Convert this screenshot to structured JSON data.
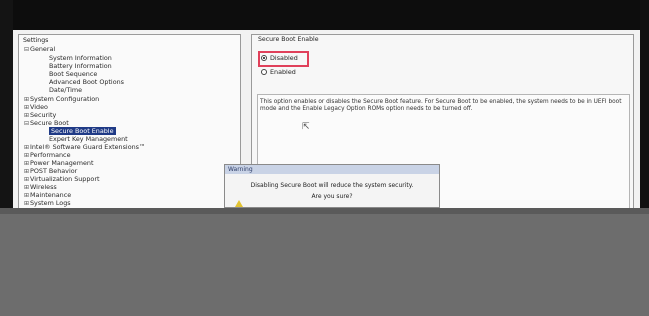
{
  "tree": {
    "title": "Settings",
    "items": [
      {
        "label": "General",
        "toggle": "⊟"
      },
      {
        "label": "System Information",
        "toggle": ""
      },
      {
        "label": "Battery Information",
        "toggle": ""
      },
      {
        "label": "Boot Sequence",
        "toggle": ""
      },
      {
        "label": "Advanced Boot Options",
        "toggle": ""
      },
      {
        "label": "Date/Time",
        "toggle": ""
      },
      {
        "label": "System Configuration",
        "toggle": "⊞"
      },
      {
        "label": "Video",
        "toggle": "⊞"
      },
      {
        "label": "Security",
        "toggle": "⊞"
      },
      {
        "label": "Secure Boot",
        "toggle": "⊟"
      },
      {
        "label": "Secure Boot Enable",
        "toggle": ""
      },
      {
        "label": "Expert Key Management",
        "toggle": ""
      },
      {
        "label": "Intel® Software Guard Extensions™",
        "toggle": "⊞"
      },
      {
        "label": "Performance",
        "toggle": "⊞"
      },
      {
        "label": "Power Management",
        "toggle": "⊞"
      },
      {
        "label": "POST Behavior",
        "toggle": "⊞"
      },
      {
        "label": "Virtualization Support",
        "toggle": "⊞"
      },
      {
        "label": "Wireless",
        "toggle": "⊞"
      },
      {
        "label": "Maintenance",
        "toggle": "⊞"
      },
      {
        "label": "System Logs",
        "toggle": "⊞"
      }
    ]
  },
  "content": {
    "title": "Secure Boot Enable",
    "options": [
      {
        "label": "Disabled",
        "selected": true
      },
      {
        "label": "Enabled",
        "selected": false
      }
    ],
    "description": "This option enables or disables the Secure Boot feature. For Secure Boot to be enabled, the system needs to be in UEFI boot mode and the Enable Legacy Option ROMs option needs to be turned off."
  },
  "dialog": {
    "title": "Warning",
    "message": "Disabling Secure Boot will reduce the system security.",
    "question": "Are you sure?"
  },
  "colors": {
    "selection": "#1f3a86",
    "highlight_box": "#e0405a",
    "dialog_title_bar": "#c9d3e6"
  }
}
